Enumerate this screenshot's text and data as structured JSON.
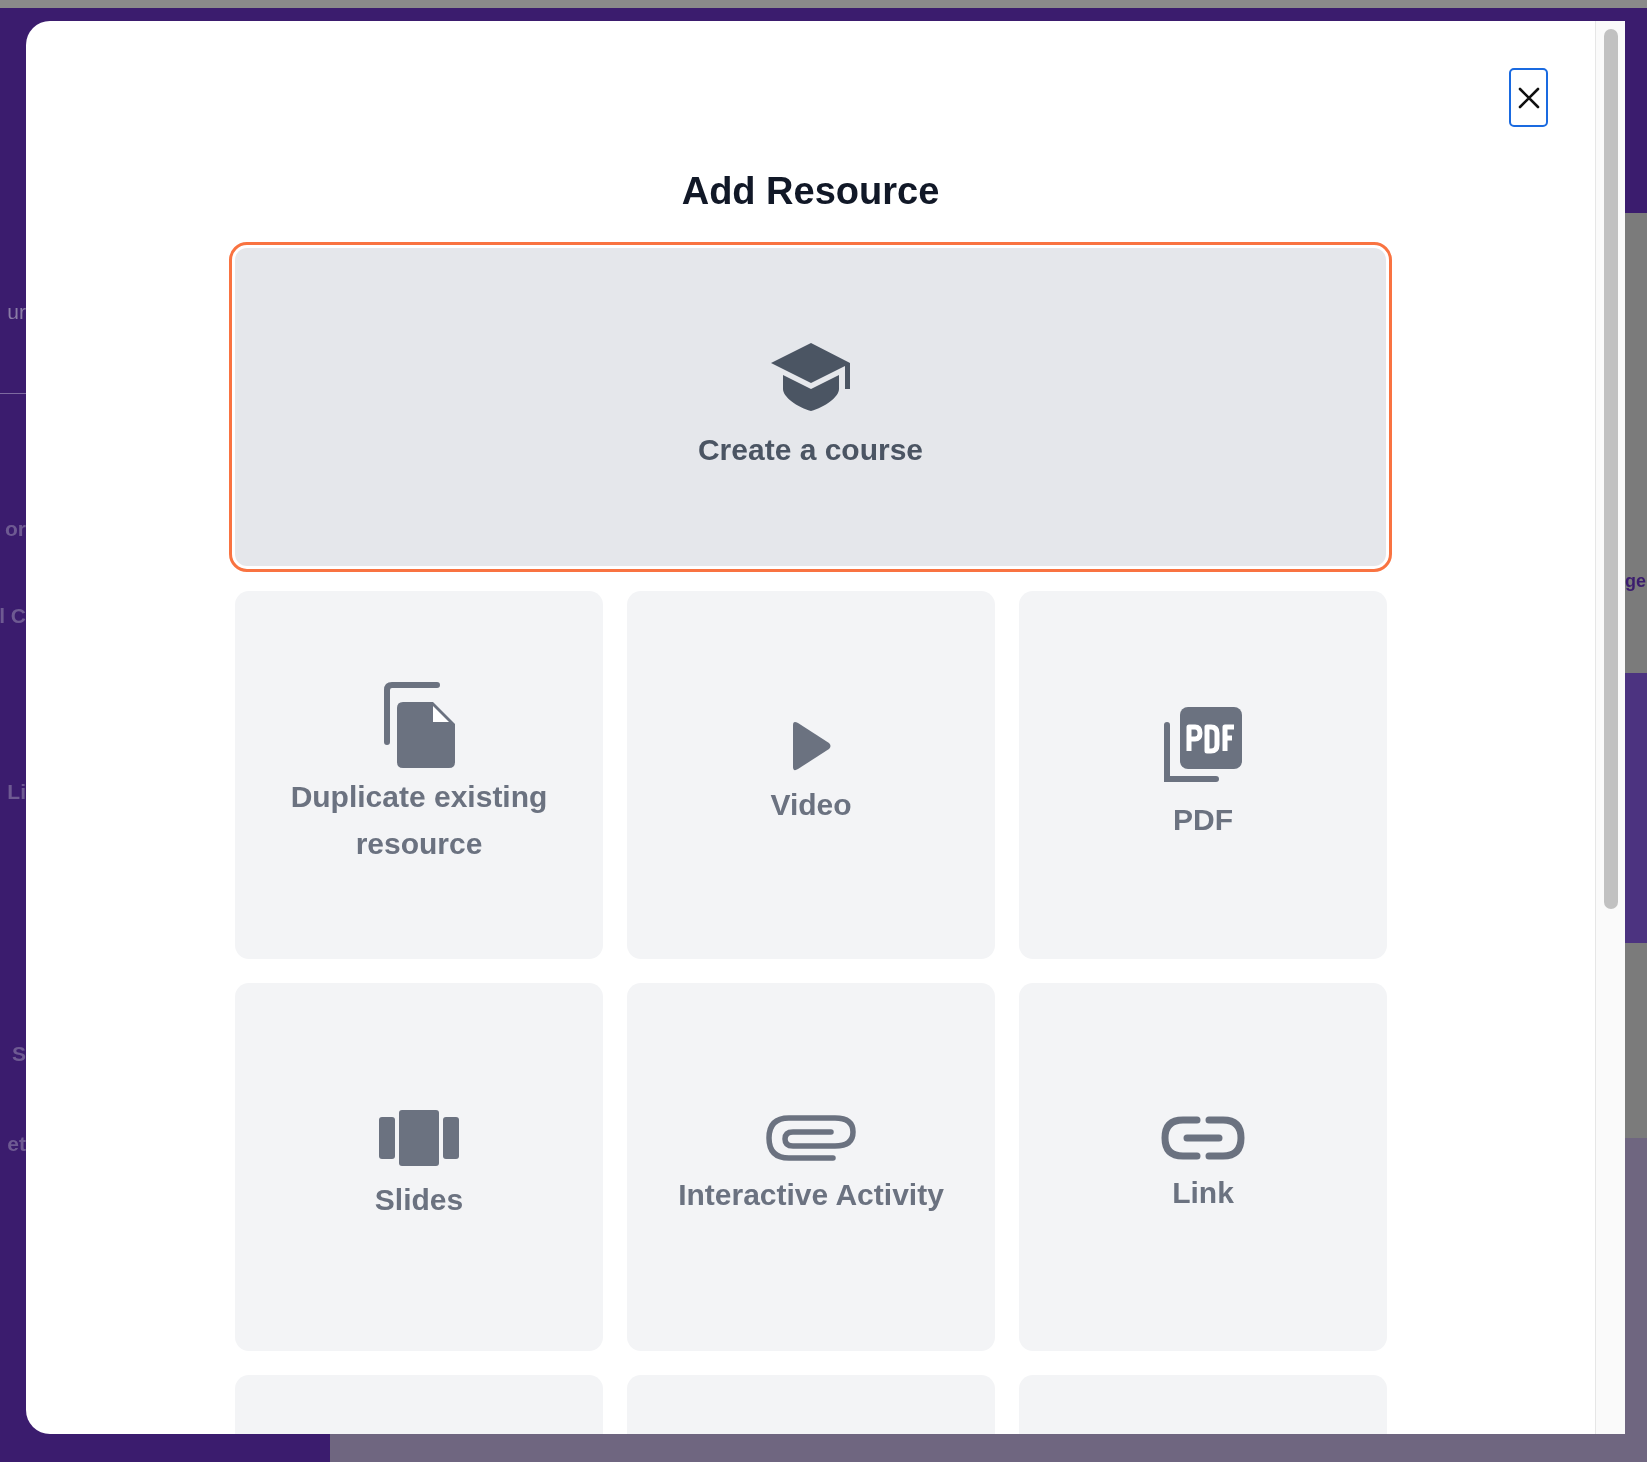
{
  "background_page": {
    "left_fragments": [
      "ur",
      "or",
      "l C",
      "Li",
      "S",
      "et"
    ],
    "right_fragments": [
      "ge"
    ]
  },
  "dialog": {
    "title": "Add Resource",
    "featured": {
      "label": "Create a course",
      "selected": true
    },
    "items": [
      {
        "kind": "tile",
        "label": "Duplicate existing resource"
      },
      {
        "kind": "tile",
        "label": "Video"
      },
      {
        "kind": "tile",
        "label": "PDF"
      },
      {
        "kind": "tile",
        "label": "Slides"
      },
      {
        "kind": "tile",
        "label": "Interactive Activity"
      },
      {
        "kind": "tile",
        "label": "Link"
      },
      {
        "kind": "cut"
      },
      {
        "kind": "cut"
      },
      {
        "kind": "cut"
      }
    ]
  }
}
